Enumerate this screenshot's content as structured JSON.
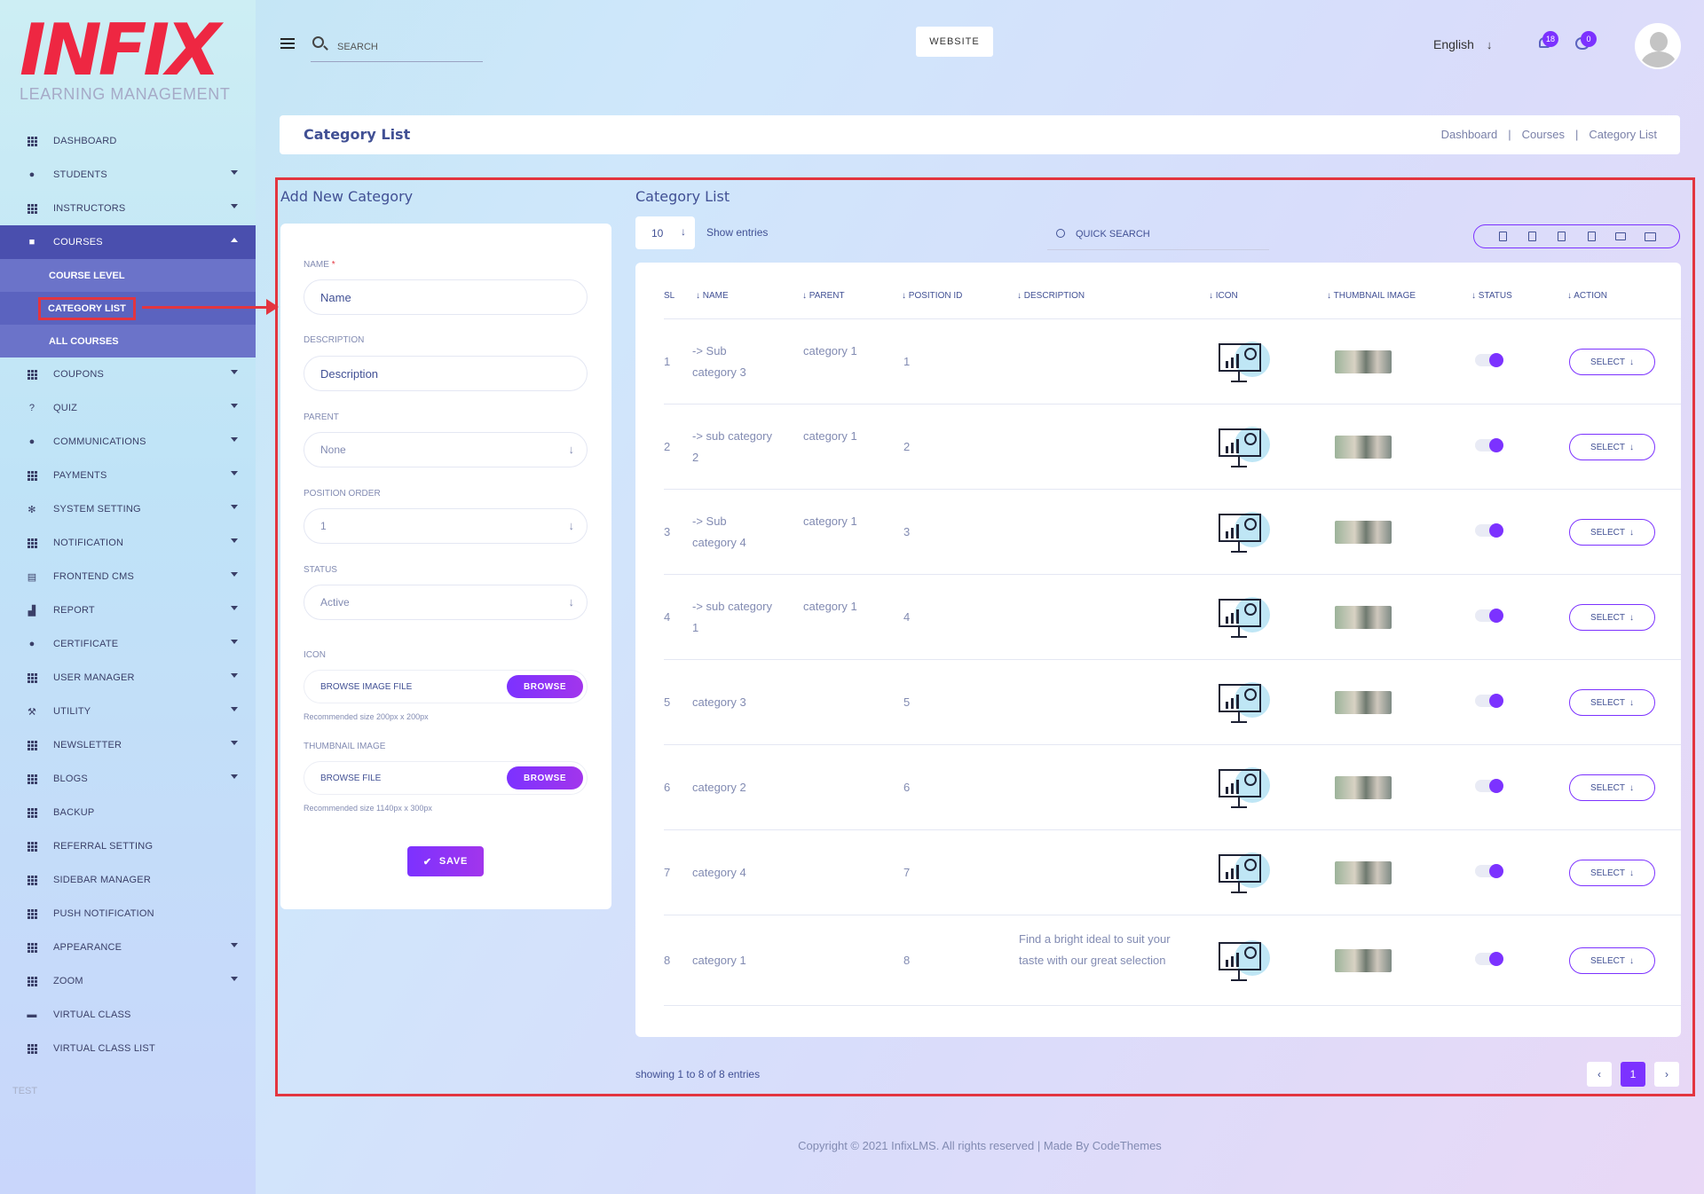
{
  "app": {
    "logo_text": "INFIX",
    "logo_subtitle": "LEARNING MANAGEMENT"
  },
  "header": {
    "search_placeholder": "SEARCH",
    "website_label": "WEBSITE",
    "language": "English",
    "notification_count": "18",
    "message_count": "0"
  },
  "sidebar": {
    "items": [
      {
        "label": "DASHBOARD",
        "icon": "grid-icon",
        "caret": false
      },
      {
        "label": "STUDENTS",
        "icon": "user-icon",
        "caret": true
      },
      {
        "label": "INSTRUCTORS",
        "icon": "grid-icon",
        "caret": true
      },
      {
        "label": "COURSES",
        "icon": "book-icon",
        "caret": true,
        "active": true
      },
      {
        "label": "COUPONS",
        "icon": "grid-icon",
        "caret": true
      },
      {
        "label": "QUIZ",
        "icon": "question-icon",
        "caret": true
      },
      {
        "label": "COMMUNICATIONS",
        "icon": "chat-icon",
        "caret": true
      },
      {
        "label": "PAYMENTS",
        "icon": "grid-icon",
        "caret": true
      },
      {
        "label": "SYSTEM SETTING",
        "icon": "gears-icon",
        "caret": true
      },
      {
        "label": "NOTIFICATION",
        "icon": "grid-icon",
        "caret": true
      },
      {
        "label": "FRONTEND CMS",
        "icon": "paint-roller-icon",
        "caret": true
      },
      {
        "label": "REPORT",
        "icon": "chart-icon",
        "caret": true
      },
      {
        "label": "CERTIFICATE",
        "icon": "certificate-icon",
        "caret": true
      },
      {
        "label": "USER MANAGER",
        "icon": "grid-icon",
        "caret": true
      },
      {
        "label": "UTILITY",
        "icon": "wrench-icon",
        "caret": true
      },
      {
        "label": "NEWSLETTER",
        "icon": "grid-icon",
        "caret": true
      },
      {
        "label": "BLOGS",
        "icon": "grid-icon",
        "caret": true
      },
      {
        "label": "BACKUP",
        "icon": "grid-icon",
        "caret": false
      },
      {
        "label": "REFERRAL SETTING",
        "icon": "grid-icon",
        "caret": false
      },
      {
        "label": "SIDEBAR MANAGER",
        "icon": "grid-icon",
        "caret": false
      },
      {
        "label": "PUSH NOTIFICATION",
        "icon": "grid-icon",
        "caret": false
      },
      {
        "label": "APPEARANCE",
        "icon": "grid-icon",
        "caret": true
      },
      {
        "label": "ZOOM",
        "icon": "grid-icon",
        "caret": true
      },
      {
        "label": "VIRTUAL CLASS",
        "icon": "vr-icon",
        "caret": false
      },
      {
        "label": "VIRTUAL CLASS LIST",
        "icon": "grid-icon",
        "caret": false
      }
    ],
    "courses_sub": [
      "COURSE LEVEL",
      "CATEGORY LIST",
      "ALL COURSES"
    ],
    "footer_label": "TEST"
  },
  "page": {
    "title": "Category List",
    "breadcrumbs": [
      "Dashboard",
      "Courses",
      "Category List"
    ]
  },
  "form": {
    "title": "Add New Category",
    "name_label": "NAME",
    "name_placeholder": "Name",
    "description_label": "DESCRIPTION",
    "description_placeholder": "Description",
    "parent_label": "PARENT",
    "parent_value": "None",
    "position_label": "POSITION ORDER",
    "position_value": "1",
    "status_label": "STATUS",
    "status_value": "Active",
    "icon_label": "ICON",
    "icon_file_placeholder": "BROWSE IMAGE FILE",
    "browse_label": "BROWSE",
    "icon_hint": "Recommended size 200px x 200px",
    "thumb_label": "THUMBNAIL IMAGE",
    "thumb_file_placeholder": "BROWSE FILE",
    "thumb_hint": "Recommended size 1140px x 300px",
    "save_label": "SAVE"
  },
  "list": {
    "title": "Category List",
    "entries_value": "10",
    "show_entries_label": "Show entries",
    "quick_search_placeholder": "QUICK SEARCH",
    "columns": [
      "SL",
      "NAME",
      "PARENT",
      "POSITION ID",
      "DESCRIPTION",
      "ICON",
      "THUMBNAIL IMAGE",
      "STATUS",
      "ACTION"
    ],
    "rows": [
      {
        "sl": "1",
        "name": "-> Sub category 3",
        "parent": "category 1",
        "position": "1",
        "description": "",
        "action": "SELECT",
        "status": "on"
      },
      {
        "sl": "2",
        "name": "-> sub category 2",
        "parent": "category 1",
        "position": "2",
        "description": "",
        "action": "SELECT",
        "status": "on"
      },
      {
        "sl": "3",
        "name": "-> Sub category 4",
        "parent": "category 1",
        "position": "3",
        "description": "",
        "action": "SELECT",
        "status": "on"
      },
      {
        "sl": "4",
        "name": "-> sub category 1",
        "parent": "category 1",
        "position": "4",
        "description": "",
        "action": "SELECT",
        "status": "on"
      },
      {
        "sl": "5",
        "name": "category 3",
        "parent": "",
        "position": "5",
        "description": "",
        "action": "SELECT",
        "status": "on"
      },
      {
        "sl": "6",
        "name": "category 2",
        "parent": "",
        "position": "6",
        "description": "",
        "action": "SELECT",
        "status": "on"
      },
      {
        "sl": "7",
        "name": "category 4",
        "parent": "",
        "position": "7",
        "description": "",
        "action": "SELECT",
        "status": "on"
      },
      {
        "sl": "8",
        "name": "category 1",
        "parent": "",
        "position": "8",
        "description": "Find a bright ideal to suit your taste with our great selection",
        "action": "SELECT",
        "status": "on"
      }
    ],
    "showing_text": "showing 1 to 8 of 8 entries",
    "current_page": "1"
  },
  "footer": {
    "text": "Copyright © 2021 InfixLMS. All rights reserved | Made By CodeThemes"
  },
  "colors": {
    "accent": "#7c32ff",
    "sidebar_active": "#4a4fae",
    "highlight": "#e3353f",
    "text": "#415094"
  }
}
